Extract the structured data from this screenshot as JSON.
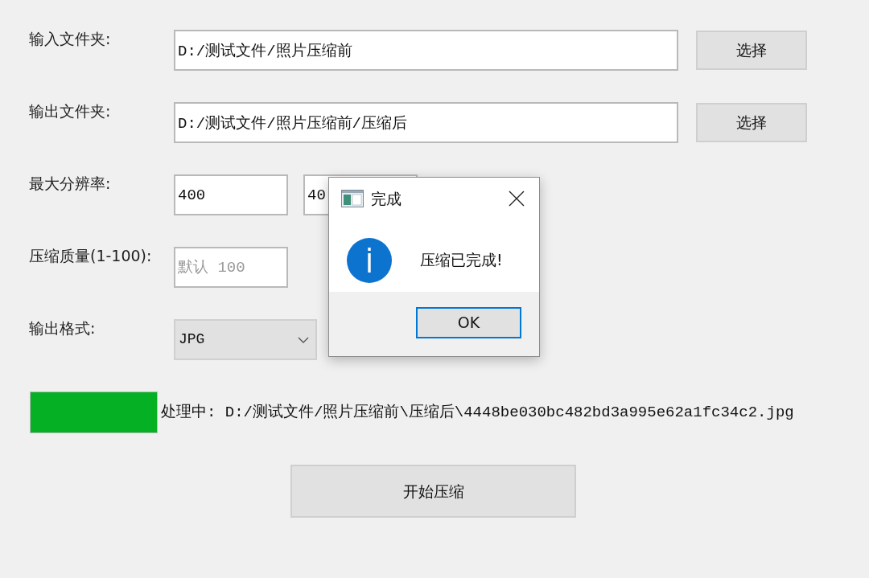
{
  "form": {
    "rows": [
      {
        "kind": "folder",
        "label": "输入文件夹:",
        "value": "D:/测试文件/照片压缩前",
        "button": "选择"
      },
      {
        "kind": "folder",
        "label": "输出文件夹:",
        "value": "D:/测试文件/照片压缩前/压缩后",
        "button": "选择"
      },
      {
        "kind": "pair",
        "label": "最大分辨率:",
        "values": [
          "400",
          "40"
        ]
      },
      {
        "kind": "text",
        "label": "压缩质量(1-100):",
        "placeholder": "默认 100"
      },
      {
        "kind": "select",
        "label": "输出格式:",
        "value": "JPG"
      }
    ]
  },
  "progress": {
    "level": 1,
    "status": "处理中: D:/测试文件/照片压缩前\\压缩后\\4448be030bc482bd3a995e62a1fc34c2.jpg"
  },
  "start_button": "开始压缩",
  "dialog": {
    "title": "完成",
    "message": "压缩已完成!",
    "button": {
      "label": "OK",
      "focused": true
    }
  }
}
